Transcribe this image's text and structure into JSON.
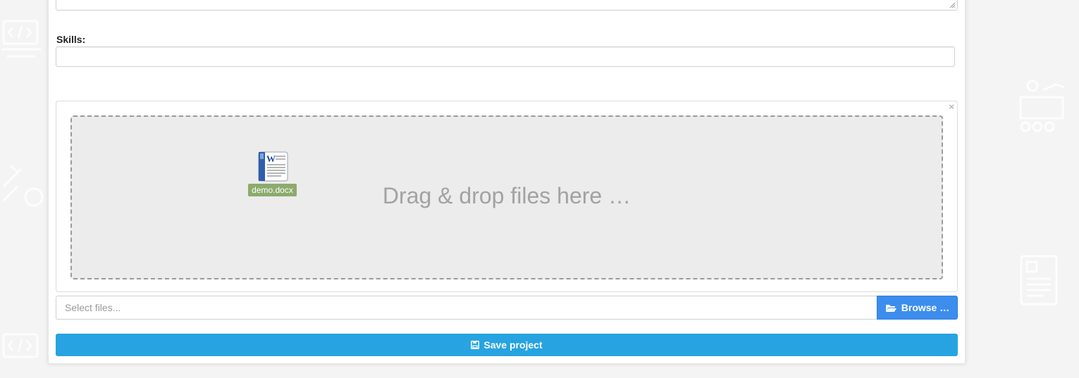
{
  "form": {
    "skills_label": "Skills:",
    "skills_value": "",
    "skills_placeholder": ""
  },
  "uploader": {
    "drop_text": "Drag & drop files here …",
    "preview_file": {
      "name": "demo.docx",
      "icon": "word-document-icon"
    },
    "close_icon": "close-icon",
    "caption_placeholder": "Select files...",
    "browse_label": "Browse …",
    "browse_icon": "folder-open-icon"
  },
  "actions": {
    "save_label": "Save project",
    "save_icon": "floppy-disk-icon"
  },
  "colors": {
    "page_background": "#f4f4f4",
    "browse_button": "#3c8dee",
    "save_button": "#27a3e2",
    "file_caption": "#8cab6c",
    "drop_area": "#ececec"
  }
}
